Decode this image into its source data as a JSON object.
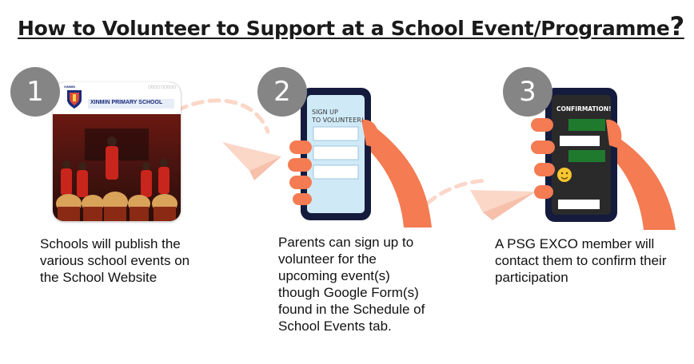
{
  "title": "How to Volunteer to Support at a School Event/Programme",
  "title_mark": "?",
  "steps": [
    {
      "number": "1",
      "caption_lines": [
        "Schools will publish the",
        "various school events on",
        "the School Website"
      ]
    },
    {
      "number": "2",
      "screen_text": [
        "SIGN UP",
        "TO VOLUNTEER!"
      ],
      "caption_lines": [
        "Parents can sign up to",
        "volunteer for the",
        "upcoming event(s)",
        "though Google Form(s)",
        "found in the Schedule of",
        "School Events tab."
      ]
    },
    {
      "number": "3",
      "screen_text": "CONFIRMATION!",
      "caption_lines": [
        "A PSG EXCO member will",
        "contact them to confirm their",
        "participation"
      ]
    }
  ],
  "website": {
    "school_name": "XINMIN PRIMARY SCHOOL",
    "logo_text": "XINMIN"
  },
  "colors": {
    "badge": "#858585",
    "hand": "#f47b52",
    "phone_body": "#141b3d",
    "signup_screen": "#cfe9f7",
    "confirm_screen": "#2a2a2a",
    "confirm_green": "#1f7a2e",
    "plane": "#fbd7c8"
  }
}
